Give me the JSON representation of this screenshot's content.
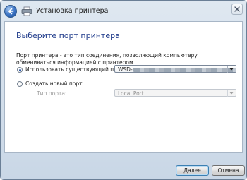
{
  "window": {
    "title": "Установка принтера"
  },
  "header": {
    "heading": "Выберите порт принтера"
  },
  "description": "Порт принтера - это тип соединения, позволяющий компьютеру обмениваться информацией с принтером.",
  "options": {
    "existing_port": {
      "label": "Использовать существующий порт:",
      "selected": true,
      "value": "WSD-"
    },
    "new_port": {
      "label": "Создать новый порт:",
      "selected": false,
      "type_label": "Тип порта:",
      "type_value": "Local Port"
    }
  },
  "buttons": {
    "next": "Далее",
    "cancel": "Отмена"
  },
  "icons": {
    "back": "back-arrow-icon",
    "printer": "printer-icon",
    "close": "close-icon",
    "dropdown": "chevron-down-icon"
  }
}
